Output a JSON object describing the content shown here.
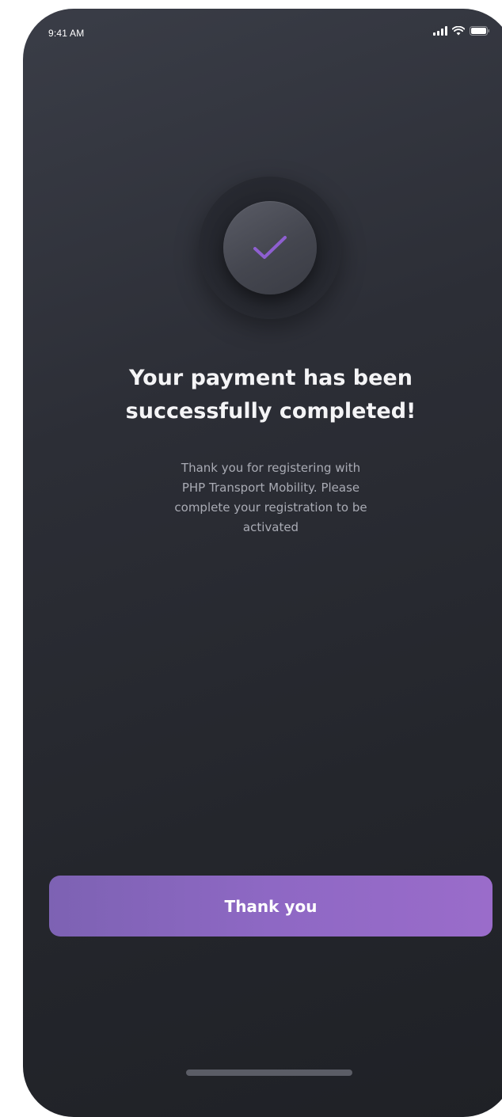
{
  "status_bar": {
    "time": "9:41 AM",
    "icons": [
      "cellular-signal-icon",
      "wifi-icon",
      "battery-icon"
    ]
  },
  "success_icon": {
    "name": "checkmark-icon",
    "color": "#8e5fd0"
  },
  "title_lines": [
    "Your payment has been",
    "successfully completed!"
  ],
  "message_lines": [
    "Thank you for registering with",
    "PHP Transport Mobility. Please",
    "complete your registration to be",
    "activated"
  ],
  "primary_button": {
    "label": "Thank you"
  },
  "colors": {
    "background": "#2c2e36",
    "accent": "#8e68c4",
    "title_text": "#f4f4f6",
    "body_text": "#a9abb4"
  }
}
